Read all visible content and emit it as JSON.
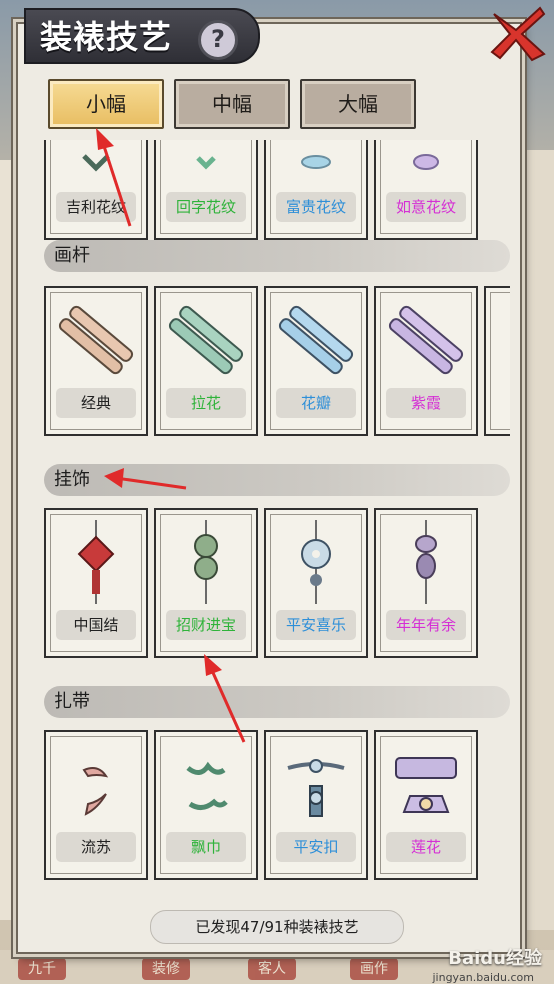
{
  "header": {
    "title": "装裱技艺",
    "help": "?"
  },
  "tabs": [
    {
      "label": "小幅",
      "active": true
    },
    {
      "label": "中幅",
      "active": false
    },
    {
      "label": "大幅",
      "active": false
    }
  ],
  "sections": {
    "top_partial": {
      "items": [
        {
          "label": "吉利花纹",
          "color": "#222222",
          "icon": "pattern-knot-icon"
        },
        {
          "label": "回字花纹",
          "color": "#2fb33a",
          "icon": "pattern-green-icon"
        },
        {
          "label": "富贵花纹",
          "color": "#2e8fd8",
          "icon": "pattern-blue-icon"
        },
        {
          "label": "如意花纹",
          "color": "#d52fd5",
          "icon": "pattern-purple-icon"
        }
      ]
    },
    "rods": {
      "title": "画杆",
      "items": [
        {
          "label": "经典",
          "color": "#222222",
          "icon": "scroll-rod-beige-icon"
        },
        {
          "label": "拉花",
          "color": "#2fb33a",
          "icon": "scroll-rod-green-icon"
        },
        {
          "label": "花瓣",
          "color": "#2e8fd8",
          "icon": "scroll-rod-blue-icon"
        },
        {
          "label": "紫霞",
          "color": "#d52fd5",
          "icon": "scroll-rod-purple-icon"
        }
      ]
    },
    "pendants": {
      "title": "挂饰",
      "items": [
        {
          "label": "中国结",
          "color": "#222222",
          "icon": "chinese-knot-icon"
        },
        {
          "label": "招财进宝",
          "color": "#2fb33a",
          "icon": "coin-pendant-icon"
        },
        {
          "label": "平安喜乐",
          "color": "#2e8fd8",
          "icon": "jade-disc-pendant-icon"
        },
        {
          "label": "年年有余",
          "color": "#d52fd5",
          "icon": "fish-pendant-icon"
        }
      ]
    },
    "ties": {
      "title": "扎带",
      "items": [
        {
          "label": "流苏",
          "color": "#222222",
          "icon": "tassel-icon"
        },
        {
          "label": "飘巾",
          "color": "#2fb33a",
          "icon": "ribbon-icon"
        },
        {
          "label": "平安扣",
          "color": "#2e8fd8",
          "icon": "buckle-icon"
        },
        {
          "label": "莲花",
          "color": "#d52fd5",
          "icon": "lotus-clasp-icon"
        }
      ]
    }
  },
  "footer": {
    "found_text": "已发现47/91种装裱技艺"
  },
  "bottom_nav": [
    "九千",
    "装修",
    "客人",
    "画作"
  ],
  "watermark": {
    "brand": "Baidu经验",
    "url": "jingyan.baidu.com"
  }
}
